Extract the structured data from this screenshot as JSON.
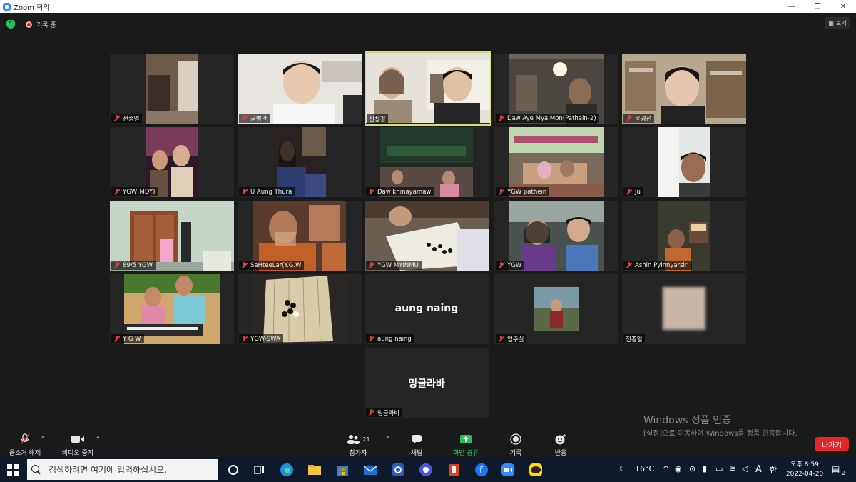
{
  "window": {
    "title": "Zoom 회의",
    "controls": [
      "—",
      "❐",
      "✕"
    ]
  },
  "topbar": {
    "recording_label": "기록 중",
    "view_label": "보기"
  },
  "participants": [
    {
      "name": "전종열",
      "muted": true
    },
    {
      "name": "공병관",
      "muted": true
    },
    {
      "name": "신창경",
      "muted": false,
      "active": true
    },
    {
      "name": "Daw Aye Mya Mon(Pathein-2)",
      "muted": true
    },
    {
      "name": "윤경선",
      "muted": true
    },
    {
      "name": "YGW(MDY)",
      "muted": true
    },
    {
      "name": "U Aung Thura",
      "muted": true
    },
    {
      "name": "Daw khinayamaw",
      "muted": true
    },
    {
      "name": "YGW pathein",
      "muted": true
    },
    {
      "name": "Ju",
      "muted": true
    },
    {
      "name": "89/5 YGW",
      "muted": true
    },
    {
      "name": "SaHteeLar(Y.G.W",
      "muted": true
    },
    {
      "name": "YGW MYINMU",
      "muted": true
    },
    {
      "name": "YGW",
      "muted": true
    },
    {
      "name": "Ashin Pyinnyarsiri",
      "muted": true
    },
    {
      "name": "Y G W",
      "muted": true
    },
    {
      "name": "YGW-SWA",
      "muted": true
    },
    {
      "name": "aung naing",
      "muted": true,
      "big_name": "aung naing"
    },
    {
      "name": "염주실",
      "muted": true
    },
    {
      "name": "전종열",
      "muted": false
    },
    {
      "name": "밍글라바",
      "muted": true,
      "big_name": "밍글라바"
    }
  ],
  "activation": {
    "line1": "Windows 정품 인증",
    "line2": "[설정]으로 이동하여 Windows를 정품 인증합니다."
  },
  "toolbar": {
    "unmute": "음소거 해제",
    "stop_video": "비디오 중지",
    "participants": "참가자",
    "participants_count": "21",
    "chat": "채팅",
    "share": "화면 공유",
    "record": "기록",
    "reactions": "반응",
    "leave": "나가기"
  },
  "taskbar": {
    "search_placeholder": "검색하려면 여기에 입력하십시오.",
    "temperature": "16°C",
    "ime": "A",
    "ime2": "한",
    "time": "오후 8:59",
    "date": "2022-04-20",
    "notif_count": "2"
  },
  "colors": {
    "accent": "#2d8cff",
    "active_speaker": "#cfe26a",
    "share_green": "#23c552",
    "leave_red": "#e02828"
  }
}
